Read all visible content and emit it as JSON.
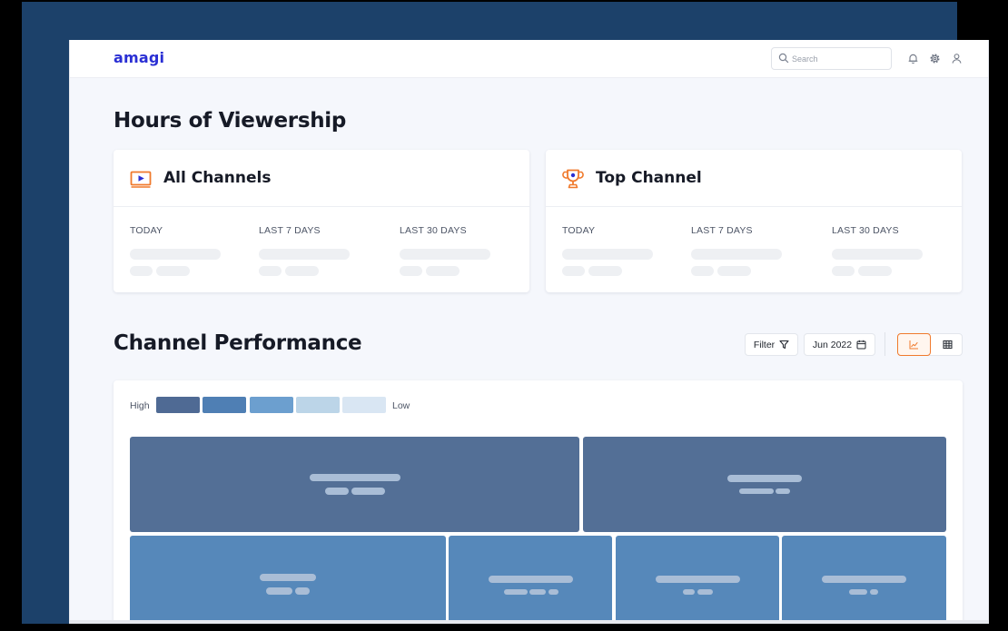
{
  "app": {
    "logo": "amagi",
    "search_placeholder": "Search"
  },
  "icons": {
    "search": "search-icon",
    "notifications": "bell-icon",
    "settings": "gear-icon",
    "profile": "user-icon",
    "all_channels": "play-icon",
    "top_channel": "trophy-icon",
    "filter": "funnel-icon",
    "date": "calendar-icon",
    "chart_view": "line-chart-icon",
    "table_view": "table-icon"
  },
  "viewership": {
    "title": "Hours of Viewership",
    "cards": [
      {
        "title": "All Channels",
        "stats": [
          "TODAY",
          "LAST 7 DAYS",
          "LAST 30 DAYS"
        ]
      },
      {
        "title": "Top Channel",
        "stats": [
          "TODAY",
          "LAST 7 DAYS",
          "LAST 30 DAYS"
        ]
      }
    ]
  },
  "performance": {
    "title": "Channel Performance",
    "filter_label": "Filter",
    "date_label": "Jun 2022",
    "legend": {
      "high": "High",
      "low": "Low",
      "scale_colors": [
        "#4f6a94",
        "#4f7fb4",
        "#6c9fcf",
        "#bcd5e8",
        "#d9e6f3"
      ]
    }
  },
  "colors": {
    "brand": "#2a2fd4",
    "accent": "#f07a2d",
    "tile_high": "#536f96",
    "tile_mid": "#5688ba",
    "backdrop": "#1c416a"
  }
}
